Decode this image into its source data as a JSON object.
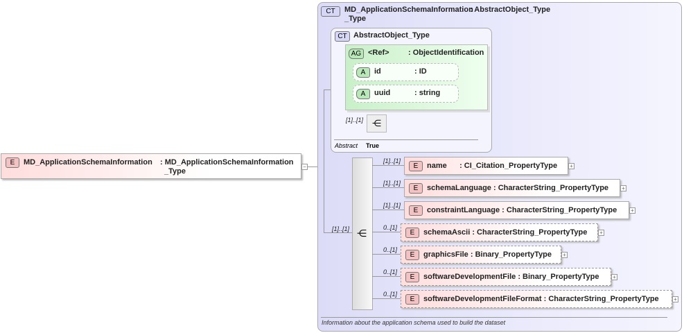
{
  "root_element": {
    "tag": "E",
    "name": "MD_ApplicationSchemaInformation",
    "type_line1": ": MD_ApplicationSchemaInformation",
    "type_line2": "_Type"
  },
  "complex_type": {
    "tag": "CT",
    "name": "MD_ApplicationSchemaInformation",
    "type_line1": ": AbstractObject_Type",
    "type_line2": "_Type",
    "documentation": "Information about the application schema used to build the dataset"
  },
  "base_type": {
    "tag": "CT",
    "name": "AbstractObject_Type",
    "abstract_label": "Abstract",
    "abstract_value": "True",
    "attribute_group": {
      "tag": "AG",
      "name": "<Ref>",
      "type": ": ObjectIdentification",
      "attributes": [
        {
          "tag": "A",
          "name": "id",
          "type": ": ID"
        },
        {
          "tag": "A",
          "name": "uuid",
          "type": ": string"
        }
      ]
    },
    "sequence_cardinality": "[1]..[1]"
  },
  "sequence_cardinality": "[1]..[1]",
  "children": [
    {
      "tag": "E",
      "card": "[1]..[1]",
      "label": "name      : CI_Citation_PropertyType"
    },
    {
      "tag": "E",
      "card": "[1]..[1]",
      "label": "schemaLanguage : CharacterString_PropertyType"
    },
    {
      "tag": "E",
      "card": "[1]..[1]",
      "label": "constraintLanguage : CharacterString_PropertyType"
    },
    {
      "tag": "E",
      "card": "0..[1]",
      "label": "schemaAscii : CharacterString_PropertyType"
    },
    {
      "tag": "E",
      "card": "0..[1]",
      "label": "graphicsFile : Binary_PropertyType"
    },
    {
      "tag": "E",
      "card": "0..[1]",
      "label": "softwareDevelopmentFile : Binary_PropertyType"
    },
    {
      "tag": "E",
      "card": "0..[1]",
      "label": "softwareDevelopmentFileFormat : CharacterString_PropertyType"
    }
  ]
}
